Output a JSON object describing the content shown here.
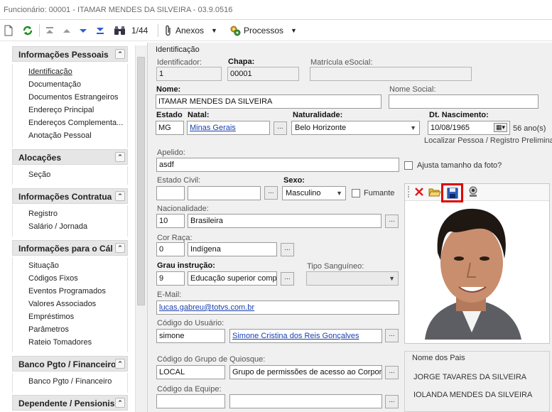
{
  "window": {
    "title": "Funcionário: 00001 - ITAMAR MENDES DA SILVEIRA - 03.9.0516"
  },
  "toolbar": {
    "counter": "1/44",
    "anexos": "Anexos",
    "processos": "Processos"
  },
  "sidebar": {
    "sections": [
      {
        "title": "Informações Pessoais",
        "items": [
          "Identificação",
          "Documentação",
          "Documentos Estrangeiros",
          "Endereço Principal",
          "Endereços Complementa...",
          "Anotação Pessoal"
        ]
      },
      {
        "title": "Alocações",
        "items": [
          "Seção"
        ]
      },
      {
        "title": "Informações Contratua",
        "items": [
          "Registro",
          "Salário / Jornada"
        ]
      },
      {
        "title": "Informações para o Cál",
        "items": [
          "Situação",
          "Códigos Fixos",
          "Eventos Programados",
          "Valores Associados",
          "Empréstimos",
          "Parâmetros",
          "Rateio Tomadores"
        ]
      },
      {
        "title": "Banco Pgto / Financeiro",
        "items": [
          "Banco Pgto / Financeiro"
        ]
      },
      {
        "title": "Dependente / Pensionis",
        "items": []
      }
    ],
    "collapse_glyph": "⌃"
  },
  "form": {
    "section_title": "Identificação",
    "identificador": {
      "label": "Identificador:",
      "value": "1"
    },
    "chapa": {
      "label": "Chapa:",
      "value": "00001"
    },
    "matricula": {
      "label": "Matrícula eSocial:",
      "value": ""
    },
    "nome": {
      "label": "Nome:",
      "value": "ITAMAR MENDES DA SILVEIRA"
    },
    "nome_social": {
      "label": "Nome Social:",
      "value": ""
    },
    "estado": {
      "label": "Estado",
      "value": "MG"
    },
    "natal": {
      "label": "Natal:",
      "value": "Minas Gerais"
    },
    "naturalidade": {
      "label": "Naturalidade:",
      "value": "Belo Horizonte"
    },
    "dt_nascimento": {
      "label": "Dt. Nascimento:",
      "value": "10/08/1965",
      "age": "56 ano(s)"
    },
    "localizar": "Localizar Pessoa / Registro Preliminar",
    "apelido": {
      "label": "Apelido:",
      "value": "asdf"
    },
    "ajusta": "Ajusta tamanho da foto?",
    "estado_civil": {
      "label": "Estado Civil:",
      "value": ""
    },
    "sexo": {
      "label": "Sexo:",
      "value": "Masculino"
    },
    "fumante": "Fumante",
    "nacionalidade": {
      "label": "Nacionalidade:",
      "code": "10",
      "value": "Brasileira"
    },
    "cor_raca": {
      "label": "Cor Raça:",
      "code": "0",
      "value": "Indígena"
    },
    "grau": {
      "label": "Grau instrução:",
      "code": "9",
      "value": "Educação superior compl"
    },
    "tipo_sanguineo": {
      "label": "Tipo Sanguíneo:",
      "value": ""
    },
    "email": {
      "label": "E-Mail:",
      "value": "lucas.gabreu@totvs.com.br"
    },
    "codigo_usuario": {
      "label": "Código do Usuário:",
      "code": "simone",
      "value": "Simone Cristina dos Reis Gonçalves"
    },
    "grupo_quiosque": {
      "label": "Código do Grupo de Quiosque:",
      "code": "LOCAL",
      "value": "Grupo de permissões de acesso ao Corporel"
    },
    "codigo_equipe": {
      "label": "Código da Equipe:",
      "code": "",
      "value": ""
    },
    "ellipsis": "...",
    "dropdown_arrow": "▼"
  },
  "pais": {
    "title": "Nome dos Pais",
    "pai": "JORGE TAVARES DA SILVEIRA",
    "mae": "IOLANDA  MENDES DA SILVEIRA"
  },
  "colors": {
    "accent": "#1a3fb0",
    "highlight": "#e00000",
    "panel": "#f0f0f0"
  }
}
